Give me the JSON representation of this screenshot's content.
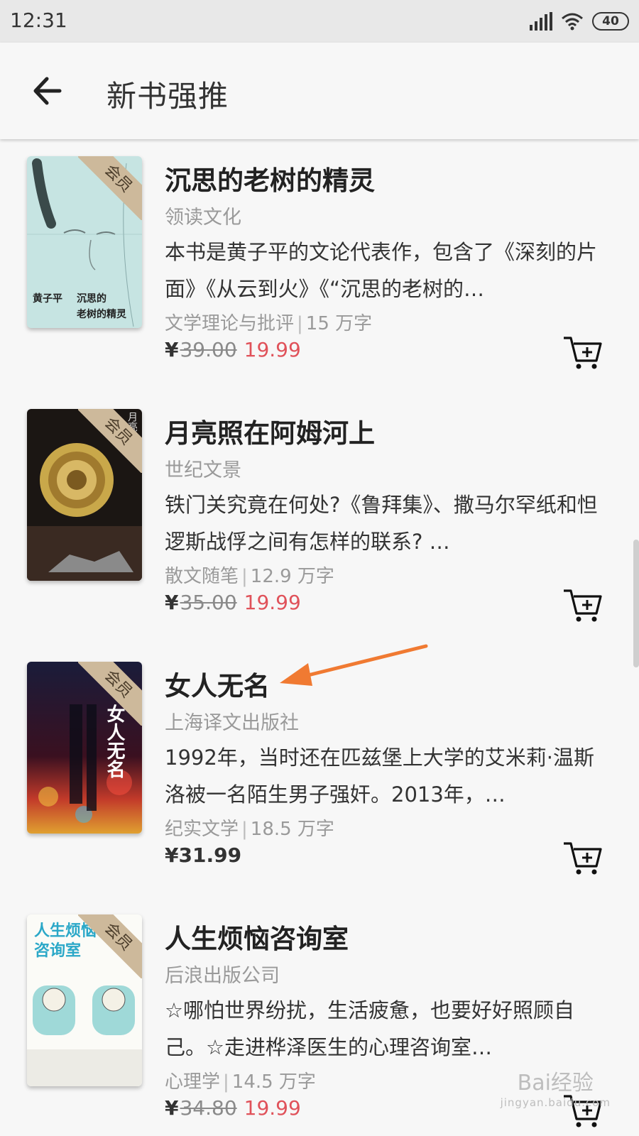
{
  "status_bar": {
    "time": "12:31",
    "battery": "40"
  },
  "app_bar": {
    "title": "新书强推"
  },
  "labels": {
    "member_badge": "会员",
    "currency": "¥"
  },
  "books": [
    {
      "title": "沉思的老树的精灵",
      "publisher": "领读文化",
      "description": "本书是黄子平的文论代表作，包含了《深刻的片面》《从云到火》《“沉思的老树的…",
      "category": "文学理论与批评",
      "word_count": "15 万字",
      "original_price": "39.00",
      "sale_price": "19.99",
      "cover_text": {
        "author": "黄子平",
        "title": "沉思的\n老树的精灵"
      }
    },
    {
      "title": "月亮照在阿姆河上",
      "publisher": "世纪文景",
      "description": "铁门关究竟在何处?《鲁拜集》、撒马尔罕纸和怛逻斯战俘之间有怎样的联系? …",
      "category": "散文随笔",
      "word_count": "12.9 万字",
      "original_price": "35.00",
      "sale_price": "19.99",
      "cover_text": {
        "title": "月亮照"
      }
    },
    {
      "title": "女人无名",
      "publisher": "上海译文出版社",
      "description": "1992年，当时还在匹兹堡上大学的艾米莉·温斯洛被一名陌生男子强奸。2013年，…",
      "category": "纪实文学",
      "word_count": "18.5 万字",
      "price": "31.99",
      "cover_text": {
        "title": "女人无名"
      }
    },
    {
      "title": "人生烦恼咨询室",
      "publisher": "后浪出版公司",
      "description": "☆哪怕世界纷扰，生活疲惫，也要好好照顾自己。☆走进桦泽医生的心理咨询室…",
      "category": "心理学",
      "word_count": "14.5 万字",
      "original_price": "34.80",
      "sale_price": "19.99",
      "cover_text": {
        "title": "人生烦恼\n咨询室"
      }
    }
  ],
  "watermark": {
    "text": "Bai经验",
    "sub": "jingyan.baidu.com"
  },
  "colors": {
    "sale_price": "#e0525a",
    "badge": "#cdb99b",
    "annotation_arrow": "#f07a32"
  }
}
